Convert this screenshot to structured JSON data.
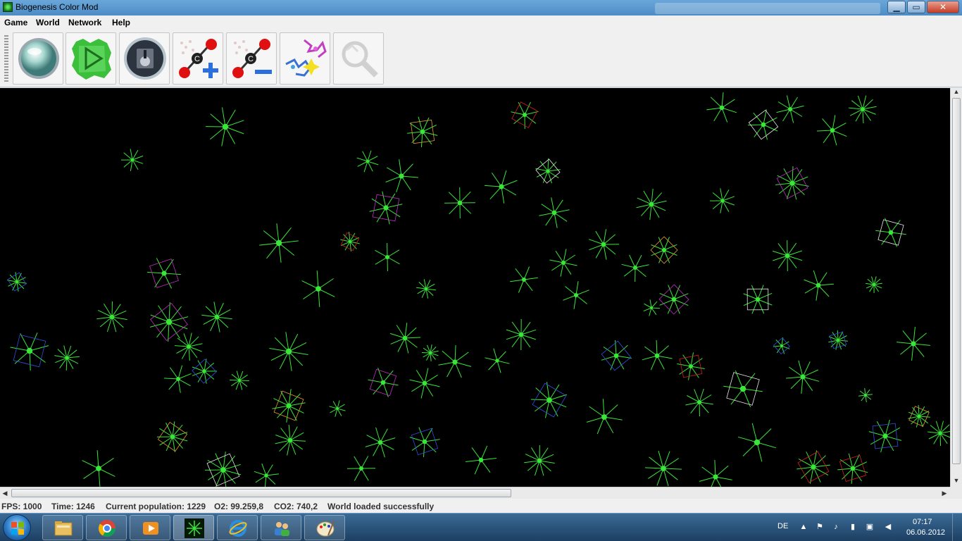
{
  "window": {
    "title": "Biogenesis Color Mod",
    "minimize_glyph": "▁",
    "maximize_glyph": "▭",
    "close_glyph": "✕"
  },
  "menu": {
    "items": [
      {
        "label": "Game"
      },
      {
        "label": "World"
      },
      {
        "label": "Network"
      },
      {
        "label": "Help"
      }
    ]
  },
  "toolbar": {
    "tools": [
      {
        "icon": "new-world-icon",
        "enabled": true
      },
      {
        "icon": "start-icon",
        "enabled": true
      },
      {
        "icon": "save-icon",
        "enabled": true
      },
      {
        "icon": "increase-co2-icon",
        "enabled": true
      },
      {
        "icon": "decrease-co2-icon",
        "enabled": true
      },
      {
        "icon": "manipulate-organisms-icon",
        "enabled": true
      },
      {
        "icon": "magnify-icon",
        "enabled": false
      }
    ]
  },
  "status": {
    "fps": "FPS: 1000",
    "time": "Time: 1246",
    "population": "Current population: 1229",
    "o2": "O2: 99.259,8",
    "co2": "CO2: 740,2",
    "message": "World loaded successfully"
  },
  "scrollbars": {
    "up_glyph": "▲",
    "down_glyph": "▼",
    "left_glyph": "◀",
    "right_glyph": "▶"
  },
  "taskbar": {
    "apps": [
      {
        "icon": "file-explorer-icon"
      },
      {
        "icon": "chrome-icon"
      },
      {
        "icon": "media-player-icon"
      },
      {
        "icon": "biogenesis-icon",
        "active": true
      },
      {
        "icon": "internet-explorer-icon"
      },
      {
        "icon": "users-icon"
      },
      {
        "icon": "paint-icon"
      }
    ],
    "language": "DE",
    "time": "07:17",
    "date": "06.06.2012"
  },
  "colors": {
    "organism_green": "#39e639",
    "organism_red": "#d02020",
    "organism_blue": "#3050e0",
    "organism_orange": "#e0a030",
    "organism_white": "#e8e8e8",
    "organism_magenta": "#c030c0",
    "world_background": "#000000"
  }
}
